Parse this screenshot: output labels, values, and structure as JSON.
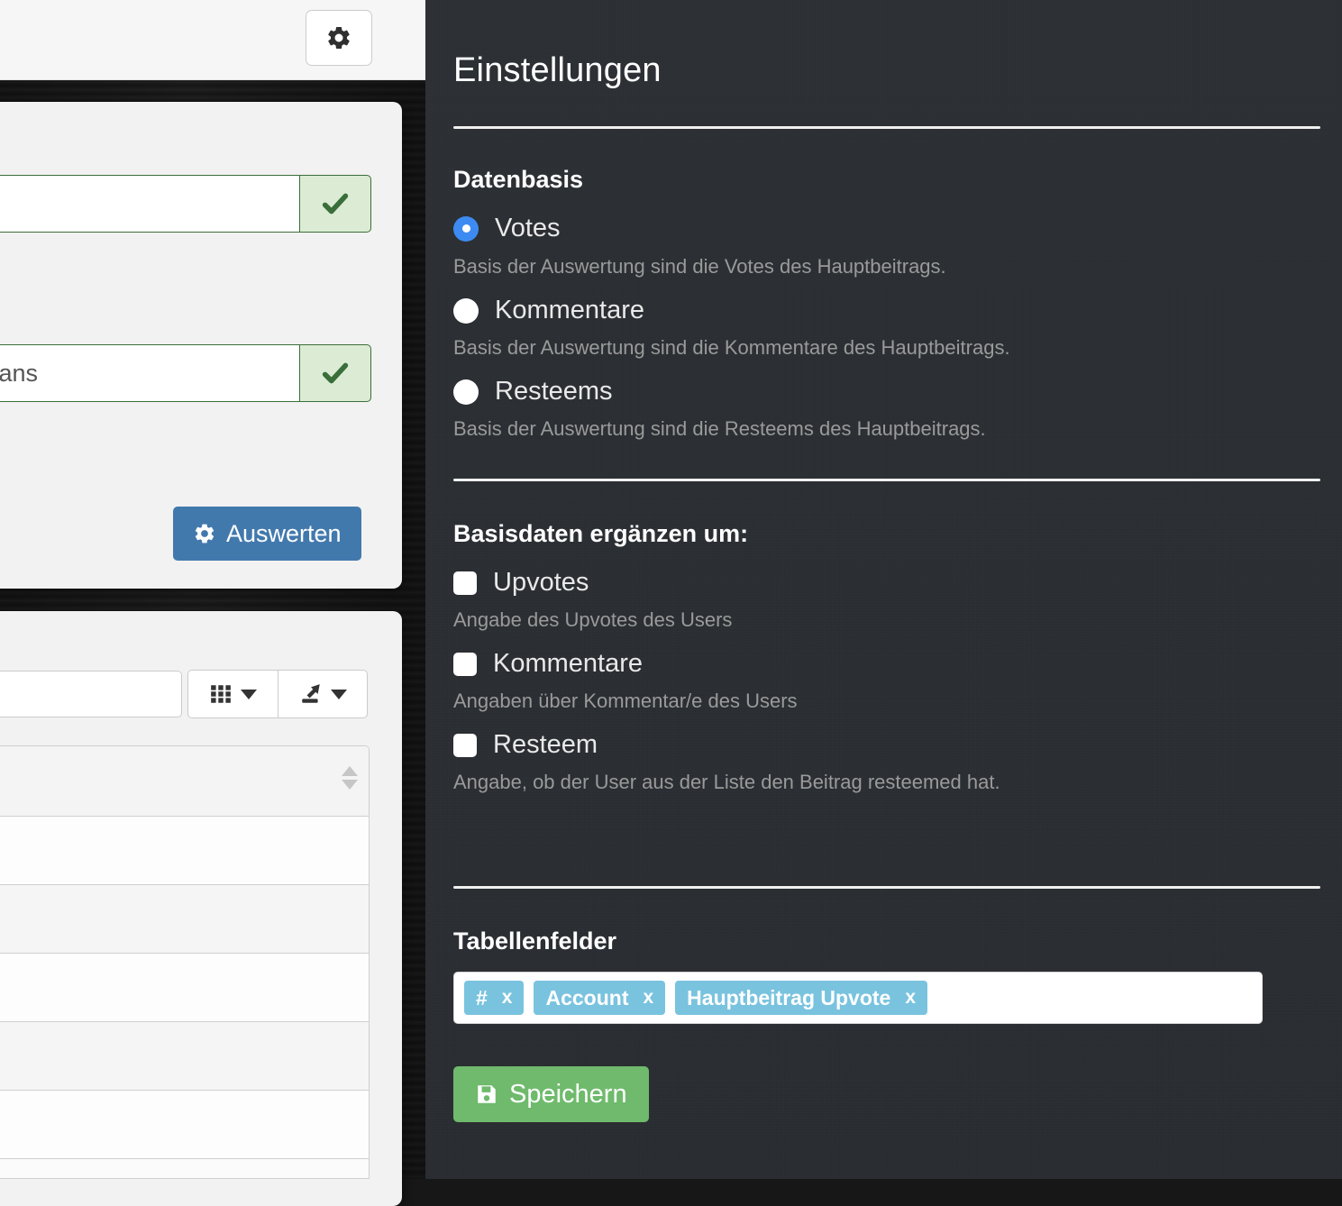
{
  "left_panel": {
    "gear_button_icon": "gear-icon",
    "form": {
      "field1_value": "",
      "field1_placeholder": "",
      "field1_valid_icon": "check-icon",
      "field2_value": "emians",
      "field2_placeholder": "",
      "field2_valid_icon": "check-icon",
      "submit_label": "Auswerten",
      "submit_icon": "gear-icon"
    },
    "table_toolbar": {
      "search_value": "",
      "search_placeholder": "",
      "columns_icon": "grid-icon",
      "columns_caret_icon": "caret-down-icon",
      "export_icon": "export-icon",
      "export_caret_icon": "caret-down-icon"
    },
    "table": {
      "sort_icon": "sort-updown-icon",
      "rows": [
        "",
        "",
        "",
        "",
        ""
      ]
    }
  },
  "drawer": {
    "title": "Einstellungen",
    "datenbasis": {
      "heading": "Datenbasis",
      "options": [
        {
          "label": "Votes",
          "desc": "Basis der Auswertung sind die Votes des Hauptbeitrags.",
          "selected": true
        },
        {
          "label": "Kommentare",
          "desc": "Basis der Auswertung sind die Kommentare des Hauptbeitrags.",
          "selected": false
        },
        {
          "label": "Resteems",
          "desc": "Basis der Auswertung sind die Resteems des Hauptbeitrags.",
          "selected": false
        }
      ]
    },
    "basisdaten": {
      "heading": "Basisdaten ergänzen um:",
      "options": [
        {
          "label": "Upvotes",
          "desc": "Angabe des Upvotes des Users",
          "checked": false
        },
        {
          "label": "Kommentare",
          "desc": "Angaben über Kommentar/e des Users",
          "checked": false
        },
        {
          "label": "Resteem",
          "desc": "Angabe, ob der User aus der Liste den Beitrag resteemed hat.",
          "checked": false
        }
      ]
    },
    "tabellenfelder": {
      "heading": "Tabellenfelder",
      "tags": [
        {
          "label": "#",
          "remove": "x"
        },
        {
          "label": "Account",
          "remove": "x"
        },
        {
          "label": "Hauptbeitrag Upvote",
          "remove": "x"
        }
      ]
    },
    "save_label": "Speichern",
    "save_icon": "save-floppy-icon"
  },
  "colors": {
    "drawer_bg": "#2b2f33",
    "radio_accent": "#3d8bf2",
    "tag_bg": "#79c3df",
    "save_green": "#6fba6c",
    "primary_blue": "#4279ad",
    "valid_green": "#3a6e3a"
  }
}
